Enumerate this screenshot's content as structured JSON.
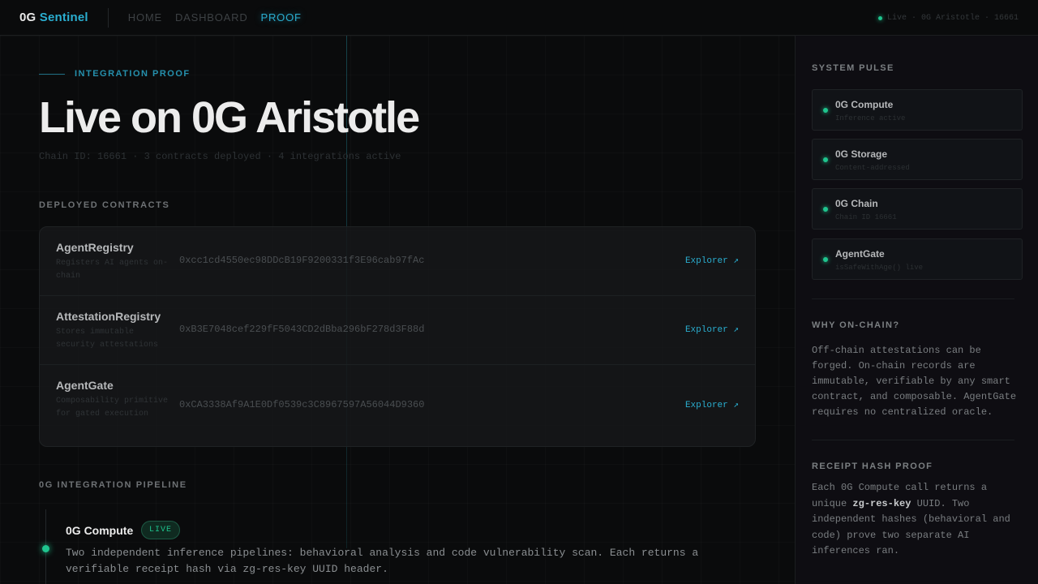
{
  "nav": {
    "brand_prefix": "0G",
    "brand_accent": "Sentinel",
    "links": [
      "HOME",
      "DASHBOARD",
      "PROOF"
    ],
    "active": "PROOF",
    "status": "Live · 0G Aristotle · 16661"
  },
  "hero": {
    "eyebrow": "INTEGRATION PROOF",
    "title": "Live on 0G Aristotle",
    "subtitle": "Chain ID: 16661 · 3 contracts deployed · 4 integrations active"
  },
  "contracts": {
    "title": "DEPLOYED CONTRACTS",
    "items": [
      {
        "name": "AgentRegistry",
        "desc": "Registers AI agents on-chain",
        "address": "0xcc1cd4550ec98DDcB19F9200331f3E96cab97fAc",
        "link": "Explorer ↗"
      },
      {
        "name": "AttestationRegistry",
        "desc": "Stores immutable security attestations",
        "address": "0xB3E7048cef229fF5043CD2dBba296bF278d3F88d",
        "link": "Explorer ↗"
      },
      {
        "name": "AgentGate",
        "desc": "Composability primitive for gated execution",
        "address": "0xCA3338Af9A1E0Df0539c3C8967597A56044D9360",
        "link": "Explorer ↗"
      }
    ]
  },
  "pipeline": {
    "title": "0G INTEGRATION PIPELINE",
    "item": {
      "name": "0G Compute",
      "badge": "LIVE",
      "desc": "Two independent inference pipelines: behavioral analysis and code vulnerability scan. Each returns a verifiable receipt hash via zg-res-key UUID header."
    }
  },
  "side": {
    "pulse_title": "SYSTEM PULSE",
    "pulse": [
      {
        "name": "0G Compute",
        "sub": "Inference active"
      },
      {
        "name": "0G Storage",
        "sub": "Content-addressed"
      },
      {
        "name": "0G Chain",
        "sub": "Chain ID 16661"
      },
      {
        "name": "AgentGate",
        "sub": "isSafeWithAge() live"
      }
    ],
    "why_title": "WHY ON-CHAIN?",
    "why_body": "Off-chain attestations can be forged. On-chain records are immutable, verifiable by any smart contract, and composable. AgentGate requires no centralized oracle.",
    "receipt_title": "RECEIPT HASH PROOF",
    "receipt_pre": "Each 0G Compute call returns a unique ",
    "receipt_code": "zg-res-key",
    "receipt_post": " UUID. Two independent hashes (behavioral and code) prove two separate AI inferences ran."
  },
  "colors": {
    "accent": "#2aaed0",
    "live": "#1fc48e",
    "background": "#0a0b0c"
  }
}
